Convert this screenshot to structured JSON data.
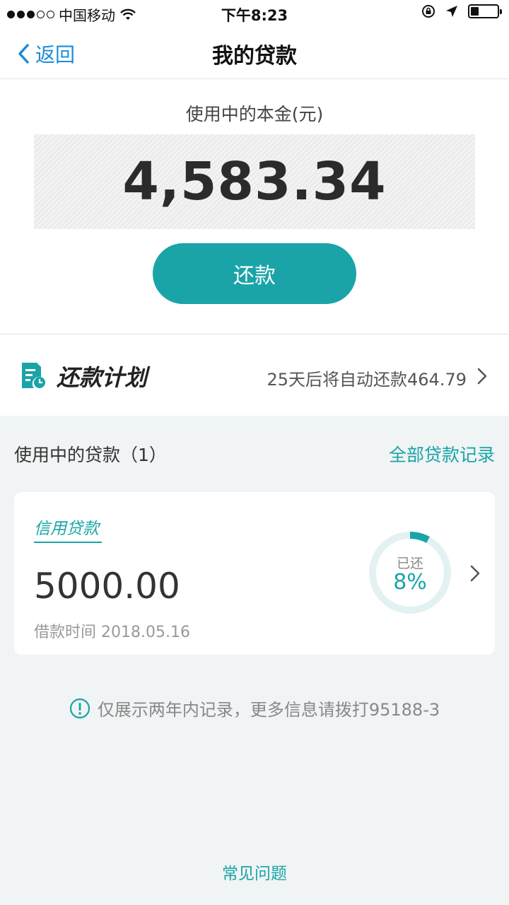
{
  "status_bar": {
    "carrier": "中国移动",
    "time": "下午8:23"
  },
  "nav": {
    "back_label": "返回",
    "title": "我的贷款"
  },
  "principal": {
    "label": "使用中的本金(元)",
    "amount": "4,583.34",
    "repay_button": "还款"
  },
  "plan": {
    "title": "还款计划",
    "info": "25天后将自动还款464.79"
  },
  "loans": {
    "header_title": "使用中的贷款（1）",
    "all_records_link": "全部贷款记录",
    "items": [
      {
        "type": "信用贷款",
        "amount": "5000.00",
        "date": "借款时间 2018.05.16",
        "progress_label": "已还",
        "progress_text": "8%",
        "progress_fraction": 0.08
      }
    ]
  },
  "notice": {
    "text": "仅展示两年内记录，更多信息请拨打95188-3"
  },
  "faq": {
    "label": "常见问题"
  },
  "colors": {
    "accent": "#1aa4a8",
    "back_blue": "#1a8cd8",
    "ring_track": "#e3f1f2"
  }
}
